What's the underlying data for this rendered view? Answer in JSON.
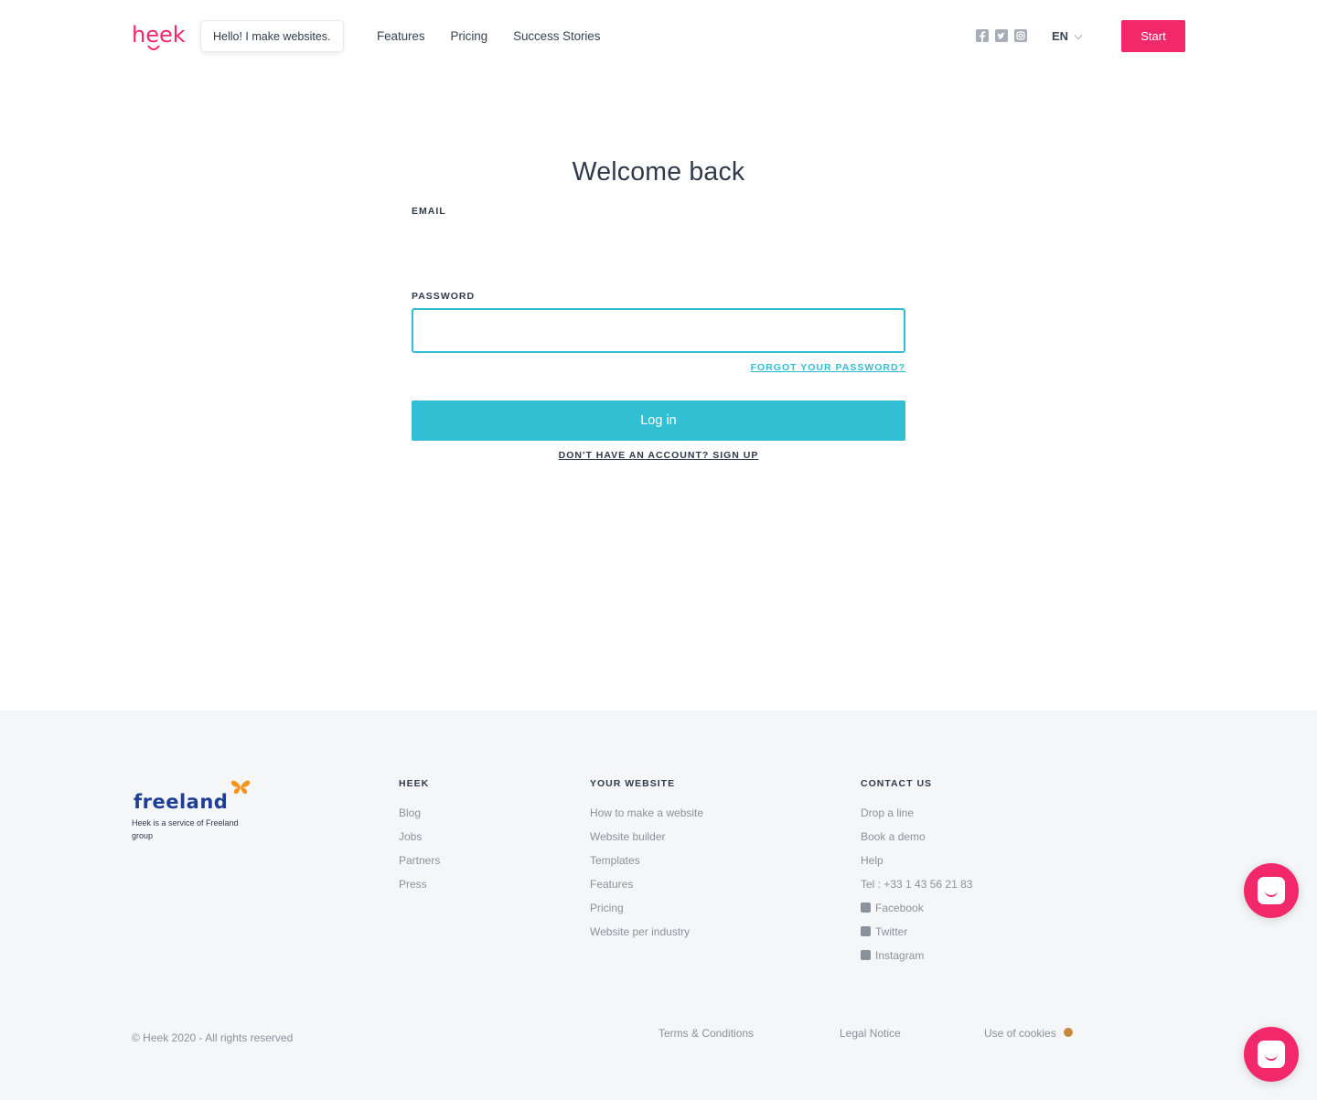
{
  "header": {
    "logo_text": "heek",
    "speech_bubble": "Hello! I make websites.",
    "nav": [
      {
        "label": "Features"
      },
      {
        "label": "Pricing"
      },
      {
        "label": "Success Stories"
      }
    ],
    "social_icons": [
      "facebook-icon",
      "twitter-icon",
      "instagram-icon"
    ],
    "language": "EN",
    "start_label": "Start"
  },
  "main": {
    "title": "Welcome back",
    "email_label": "EMAIL",
    "email_value": "",
    "password_label": "PASSWORD",
    "password_value": "",
    "forgot_label": "FORGOT YOUR PASSWORD?",
    "login_label": "Log in",
    "signup_label": "DON'T HAVE AN ACCOUNT? SIGN UP"
  },
  "footer": {
    "brand": "freeland",
    "service_text": "Heek is a service of Freeland group",
    "heek": {
      "title": "HEEK",
      "links": [
        "Blog",
        "Jobs",
        "Partners",
        "Press"
      ]
    },
    "website": {
      "title": "YOUR WEBSITE",
      "links": [
        "How to make a website",
        "Website builder",
        "Templates",
        "Features",
        "Pricing",
        "Website per industry"
      ]
    },
    "contact": {
      "title": "CONTACT US",
      "links": [
        "Drop a line",
        "Book a demo",
        "Help",
        "Tel : +33 1 43 56 21 83"
      ],
      "social": [
        "Facebook",
        "Twitter",
        "Instagram"
      ]
    },
    "copyright": "© Heek 2020 - All rights reserved",
    "terms": "Terms & Conditions",
    "legal_notice": "Legal Notice",
    "cookies": "Use of cookies"
  },
  "colors": {
    "brand_pink": "#f2286a",
    "accent_cyan": "#33bfd3",
    "text_dark": "#2f3b4b",
    "footer_bg": "#f5f6f8",
    "freeland_blue": "#1f3f95"
  }
}
